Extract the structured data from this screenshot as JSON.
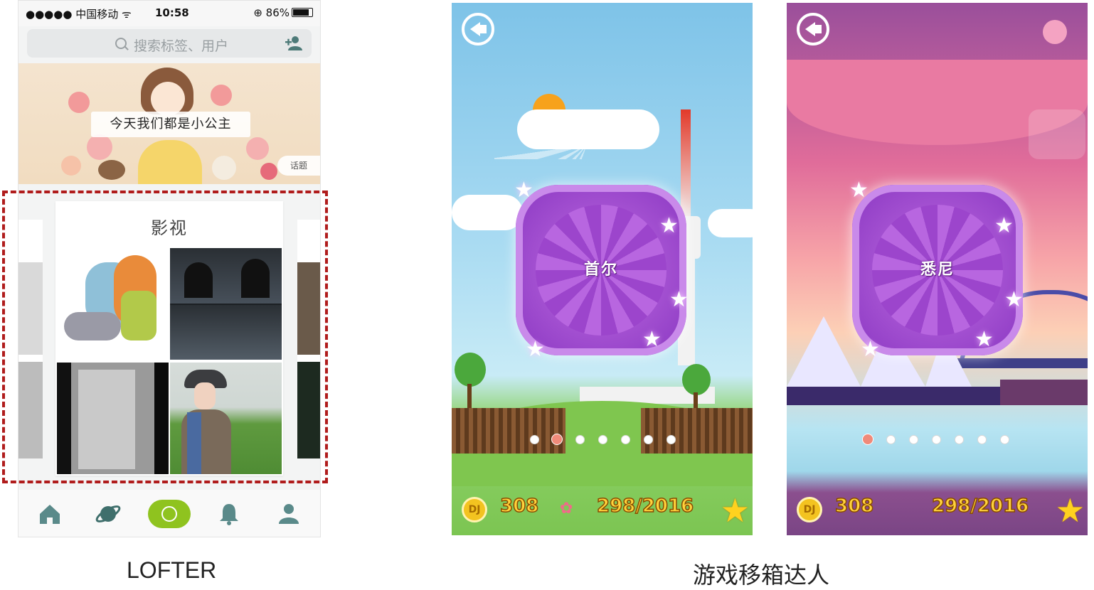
{
  "lofter": {
    "status": {
      "carrier": "●●●●● 中国移动 ᯤ",
      "time": "10:58",
      "battery": "⊕ 86%"
    },
    "search_placeholder": "搜索标签、用户",
    "banner": {
      "caption": "今天我们都是小公主",
      "tag": "话题"
    },
    "card_title": "影视",
    "caption": "LOFTER",
    "tabs": [
      {
        "name": "home-icon"
      },
      {
        "name": "planet-icon"
      },
      {
        "name": "camera-icon"
      },
      {
        "name": "bell-icon"
      },
      {
        "name": "profile-icon"
      }
    ],
    "colors": {
      "accent": "#8fc31f",
      "tab_icon": "#5a8a8a",
      "highlight": "#b01c1c"
    }
  },
  "game": {
    "caption": "游戏移箱达人",
    "screens": [
      {
        "city": "首尔",
        "coins": "308",
        "progress": "298/2016",
        "coin_label": "DJ",
        "active_dot": 2,
        "dot_count": 7
      },
      {
        "city": "悉尼",
        "coins": "308",
        "progress": "298/2016",
        "coin_label": "DJ",
        "active_dot": 1,
        "dot_count": 7
      }
    ]
  }
}
